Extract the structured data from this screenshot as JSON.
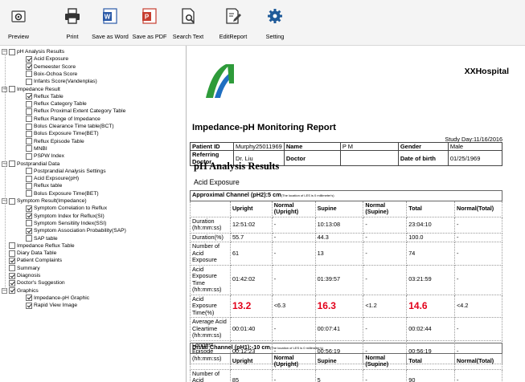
{
  "toolbar": [
    {
      "label": "Preview",
      "icon": "preview-icon"
    },
    {
      "label": "Print",
      "icon": "printer-icon"
    },
    {
      "label": "Save as Word",
      "icon": "word-icon"
    },
    {
      "label": "Save as PDF",
      "icon": "pdf-icon"
    },
    {
      "label": "Search Text",
      "icon": "search-doc-icon"
    },
    {
      "label": "EditReport",
      "icon": "edit-doc-icon"
    },
    {
      "label": "Setting",
      "icon": "gear-icon"
    }
  ],
  "tree": [
    {
      "label": "pH Analysis Results",
      "level": 0,
      "checked": false,
      "expander": "−"
    },
    {
      "label": "Acid Exposure",
      "level": 1,
      "checked": true
    },
    {
      "label": "Demeester Score",
      "level": 1,
      "checked": true
    },
    {
      "label": "Boix-Ochoa Score",
      "level": 1,
      "checked": false
    },
    {
      "label": "Infants Score(Vandenplas)",
      "level": 1,
      "checked": false
    },
    {
      "label": "Impedance Result",
      "level": 0,
      "checked": false,
      "expander": "−"
    },
    {
      "label": "Reflux Table",
      "level": 1,
      "checked": true
    },
    {
      "label": "Reflux Category Table",
      "level": 1,
      "checked": false
    },
    {
      "label": "Reflux Proximal Extent Category Table",
      "level": 1,
      "checked": false
    },
    {
      "label": "Reflux Range of Impedance",
      "level": 1,
      "checked": false
    },
    {
      "label": "Bolus Clearance Time table(BCT)",
      "level": 1,
      "checked": false
    },
    {
      "label": "Bolus Exposure Time(BET)",
      "level": 1,
      "checked": false
    },
    {
      "label": "Reflux Episode Table",
      "level": 1,
      "checked": false
    },
    {
      "label": "MNBI",
      "level": 1,
      "checked": false
    },
    {
      "label": "PSPW Index",
      "level": 1,
      "checked": false
    },
    {
      "label": "Postprandial Data",
      "level": 0,
      "checked": false,
      "expander": "−"
    },
    {
      "label": "Postprandial Analysis Settings",
      "level": 1,
      "checked": false
    },
    {
      "label": "Acid Expsoure(pH)",
      "level": 1,
      "checked": false
    },
    {
      "label": "Reflux table",
      "level": 1,
      "checked": false
    },
    {
      "label": "Bolus Exposure Time(BET)",
      "level": 1,
      "checked": false
    },
    {
      "label": "Symptom Result(Impedance)",
      "level": 0,
      "checked": false,
      "expander": "−"
    },
    {
      "label": "Symptom Correlation to Reflux",
      "level": 1,
      "checked": true
    },
    {
      "label": "Symptom Index for Reflux(SI)",
      "level": 1,
      "checked": true
    },
    {
      "label": "Symptom Sensitiity Index(SSI)",
      "level": 1,
      "checked": false
    },
    {
      "label": "Symptom Association Probability(SAP)",
      "level": 1,
      "checked": true
    },
    {
      "label": "SAP table",
      "level": 1,
      "checked": false
    },
    {
      "label": "Impedance Reflux Table",
      "level": 0,
      "checked": false
    },
    {
      "label": "Diary Data Table",
      "level": 0,
      "checked": false
    },
    {
      "label": "Patient Complaints",
      "level": 0,
      "checked": true
    },
    {
      "label": "Summary",
      "level": 0,
      "checked": false
    },
    {
      "label": "Diagnosis",
      "level": 0,
      "checked": true
    },
    {
      "label": "Doctor's Suggestion",
      "level": 0,
      "checked": true
    },
    {
      "label": "Graphics",
      "level": 0,
      "checked": true,
      "expander": "−"
    },
    {
      "label": "Impedance-pH Graphic",
      "level": 1,
      "checked": true
    },
    {
      "label": "Rapid View Image",
      "level": 1,
      "checked": true
    }
  ],
  "report": {
    "hospital": "XXHospital",
    "title": "Impedance-pH Monitoring Report",
    "study_day": "Study Day:11/16/2016",
    "patient": {
      "id_label": "Patient ID",
      "id_value": "Murphy25011969",
      "name_label": "Name",
      "name_value": "P M",
      "gender_label": "Gender",
      "gender_value": "Male",
      "ref_label": "Referring Doctor",
      "ref_value": "Dr. Liu",
      "doctor_label": "Doctor",
      "doctor_value": "",
      "dob_label": "Date of birth",
      "dob_value": "01/25/1969"
    },
    "section_title": "pH Analysis Results",
    "subsection": "Acid Exposure",
    "proximal": {
      "caption": "Approximal Channel (pH2):5 cm",
      "caption_note": "(The location of LES is 0 millimeter's)",
      "headers": [
        "",
        "Upright",
        "Normal (Upright)",
        "Supine",
        "Normal (Supine)",
        "Total",
        "Normal(Total)"
      ],
      "rows": [
        [
          "Duration (hh:mm:ss)",
          "12:51:02",
          "-",
          "10:13:08",
          "-",
          "23:04:10",
          "-"
        ],
        [
          "Duration(%)",
          "55.7",
          "-",
          "44.3",
          "-",
          "100.0",
          "-"
        ],
        [
          "Number of Acid Exposure",
          "61",
          "-",
          "13",
          "-",
          "74",
          "-"
        ],
        [
          "Acid Exposure Time (hh:mm:ss)",
          "01:42:02",
          "-",
          "01:39:57",
          "-",
          "03:21:59",
          "-"
        ],
        [
          "Acid Exposure Time(%)",
          "13.2",
          "<6.3",
          "16.3",
          "<1.2",
          "14.6",
          "<4.2"
        ],
        [
          "Average Acid Cleartime (hh:mm:ss)",
          "00:01:40",
          "-",
          "00:07:41",
          "-",
          "00:02:44",
          "-"
        ],
        [
          "Longest Episode (hh:mm:ss)",
          "00:12:23",
          "-",
          "00:56:19",
          "-",
          "00:56:19",
          "-"
        ]
      ]
    },
    "distal": {
      "caption": "Distal Channel (pH1):-10 cm",
      "caption_note": "(The location of LES is 0 millimeter's)",
      "headers": [
        "",
        "Upright",
        "Normal (Upright)",
        "Supine",
        "Normal (Supine)",
        "Total",
        "Normal(Total)"
      ],
      "rows": [
        [
          "Number of Acid Exposure",
          "85",
          "-",
          "5",
          "-",
          "90",
          "-"
        ]
      ]
    }
  },
  "colors": {
    "highlight": "#e2001a",
    "logo_green": "#2e9b3a",
    "logo_blue": "#1f6fc1"
  }
}
